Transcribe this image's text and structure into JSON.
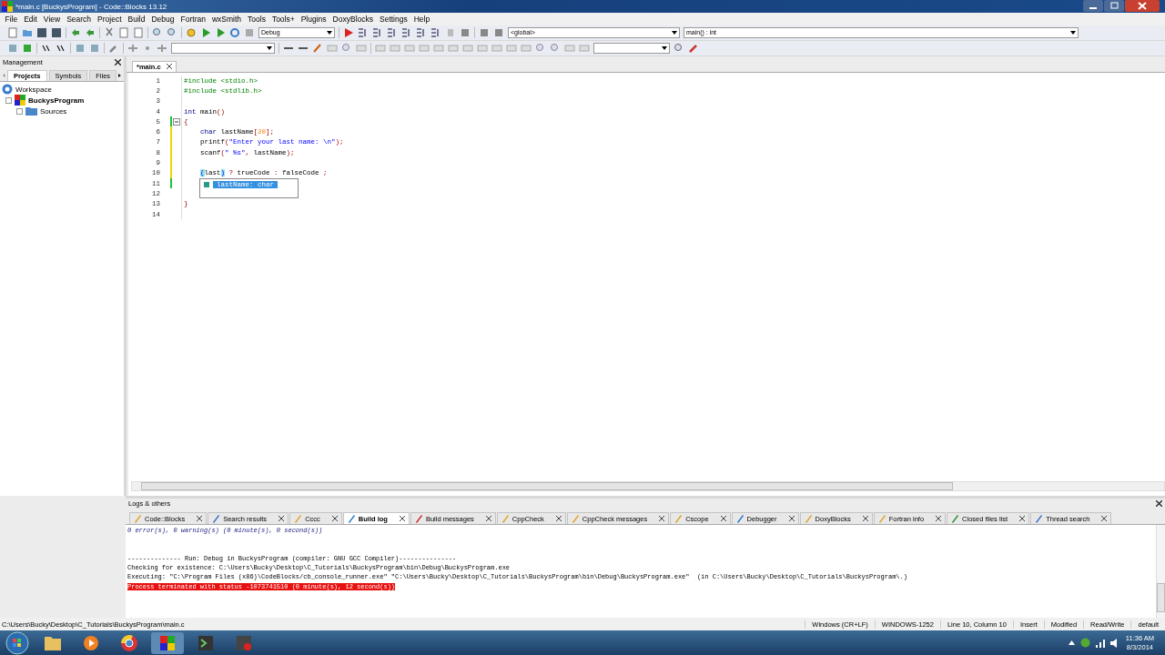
{
  "window": {
    "title": "*main.c [BuckysProgram] - Code::Blocks 13.12"
  },
  "menu": [
    "File",
    "Edit",
    "View",
    "Search",
    "Project",
    "Build",
    "Debug",
    "Fortran",
    "wxSmith",
    "Tools",
    "Tools+",
    "Plugins",
    "DoxyBlocks",
    "Settings",
    "Help"
  ],
  "toolbar": {
    "build_target": "Debug",
    "scope": "<global>",
    "function": "main() : int"
  },
  "management": {
    "title": "Management",
    "tabs": [
      {
        "label": "Projects",
        "selected": true
      },
      {
        "label": "Symbols",
        "selected": false
      },
      {
        "label": "Files",
        "selected": false
      }
    ],
    "tree": [
      {
        "label": "Workspace",
        "kind": "workspace",
        "children": [
          {
            "label": "BuckysProgram",
            "kind": "project",
            "children": [
              {
                "label": "Sources",
                "kind": "folder"
              }
            ]
          }
        ]
      }
    ]
  },
  "editor": {
    "tabs": [
      {
        "label": "*main.c",
        "selected": true
      }
    ],
    "lines": [
      {
        "number": "1",
        "tokens": [
          {
            "kind": "preproc",
            "text": "#include <stdio.h>"
          }
        ]
      },
      {
        "number": "2",
        "tokens": [
          {
            "kind": "preproc",
            "text": "#include <stdlib.h>"
          }
        ]
      },
      {
        "number": "3"
      },
      {
        "number": "4",
        "tokens": [
          {
            "kind": "keyword",
            "text": "int"
          },
          {
            "kind": "plain",
            "text": " main"
          },
          {
            "kind": "op",
            "text": "()"
          }
        ]
      },
      {
        "number": "5",
        "color": "#23c23a",
        "fold": true,
        "tokens": [
          {
            "kind": "op",
            "text": "{"
          }
        ]
      },
      {
        "number": "6",
        "color": "#ecd800",
        "indent": true,
        "tokens": [
          {
            "kind": "keyword",
            "text": "char"
          },
          {
            "kind": "plain",
            "text": " lastName"
          },
          {
            "kind": "op",
            "text": "["
          },
          {
            "kind": "number",
            "text": "20"
          },
          {
            "kind": "op",
            "text": "];"
          }
        ]
      },
      {
        "number": "7",
        "color": "#ecd800",
        "indent": true,
        "tokens": [
          {
            "kind": "plain",
            "text": "printf"
          },
          {
            "kind": "op",
            "text": "("
          },
          {
            "kind": "string",
            "text": "\"Enter your last name: \\n\""
          },
          {
            "kind": "op",
            "text": ");"
          }
        ]
      },
      {
        "number": "8",
        "color": "#ecd800",
        "indent": true,
        "tokens": [
          {
            "kind": "plain",
            "text": "scanf"
          },
          {
            "kind": "op",
            "text": "("
          },
          {
            "kind": "string",
            "text": "\" %s\""
          },
          {
            "kind": "op",
            "text": ","
          },
          {
            "kind": "plain",
            "text": " lastName"
          },
          {
            "kind": "op",
            "text": ");"
          }
        ]
      },
      {
        "number": "9",
        "color": "#ecd800"
      },
      {
        "number": "10",
        "color": "#ecd800",
        "indent": true,
        "tokens": [
          {
            "kind": "brace",
            "text": "("
          },
          {
            "kind": "plain",
            "text": "last"
          },
          {
            "kind": "brace",
            "text": ")"
          },
          {
            "kind": "op",
            "text": " ?"
          },
          {
            "kind": "plain",
            "text": " trueCode "
          },
          {
            "kind": "op",
            "text": ":"
          },
          {
            "kind": "plain",
            "text": " falseCode "
          },
          {
            "kind": "op",
            "text": ";"
          }
        ]
      },
      {
        "number": "11",
        "color": "#23c23a"
      },
      {
        "number": "12"
      },
      {
        "number": "13",
        "tokens": [
          {
            "kind": "op",
            "text": "}"
          }
        ]
      },
      {
        "number": "14"
      }
    ],
    "autocomplete": [
      {
        "label": "lastName: char",
        "selected": true
      }
    ]
  },
  "logs": {
    "title": "Logs & others",
    "tabs": [
      {
        "label": "Code::Blocks",
        "selected": false
      },
      {
        "label": "Search results",
        "selected": false
      },
      {
        "label": "Cccc",
        "selected": false
      },
      {
        "label": "Build log",
        "selected": true
      },
      {
        "label": "Build messages",
        "selected": false
      },
      {
        "label": "CppCheck",
        "selected": false
      },
      {
        "label": "CppCheck messages",
        "selected": false
      },
      {
        "label": "Cscope",
        "selected": false
      },
      {
        "label": "Debugger",
        "selected": false
      },
      {
        "label": "DoxyBlocks",
        "selected": false
      },
      {
        "label": "Fortran info",
        "selected": false
      },
      {
        "label": "Closed files list",
        "selected": false
      },
      {
        "label": "Thread search",
        "selected": false
      }
    ],
    "lines": [
      {
        "kind": "summary",
        "text": "0 error(s), 0 warning(s) (0 minute(s), 0 second(s))"
      },
      {
        "kind": "header",
        "text": "-------------- Run: Debug in BuckysProgram (compiler: GNU GCC Compiler)---------------"
      },
      {
        "kind": "plain",
        "text": "Checking for existence: C:\\Users\\Bucky\\Desktop\\C_Tutorials\\BuckysProgram\\bin\\Debug\\BuckysProgram.exe"
      },
      {
        "kind": "plain",
        "text": "Executing: \"C:\\Program Files (x86)\\CodeBlocks/cb_console_runner.exe\" \"C:\\Users\\Bucky\\Desktop\\C_Tutorials\\BuckysProgram\\bin\\Debug\\BuckysProgram.exe\"  (in C:\\Users\\Bucky\\Desktop\\C_Tutorials\\BuckysProgram\\.)"
      },
      {
        "kind": "error",
        "text": "Process terminated with status -1073741510 (0 minute(s), 12 second(s))"
      }
    ]
  },
  "status_bar": {
    "path": "C:\\Users\\Bucky\\Desktop\\C_Tutorials\\BuckysProgram\\main.c",
    "fields": [
      "Windows (CR+LF)",
      "WINDOWS-1252",
      "Line 10, Column 10",
      "Insert",
      "Modified",
      "Read/Write",
      "default"
    ]
  },
  "taskbar": {
    "time": "11:36 AM",
    "date": "8/3/2014"
  }
}
